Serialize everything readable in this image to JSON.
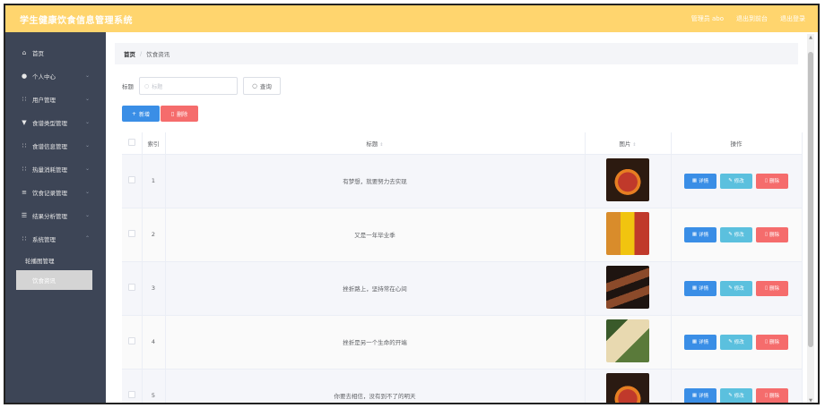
{
  "app": {
    "title": "学生健康饮食信息管理系统",
    "admin_label": "管理员 abo",
    "exit_backend": "退出到前台",
    "logout": "退出登录"
  },
  "sidebar": {
    "items": [
      {
        "label": "首页",
        "icon": "home-icon"
      },
      {
        "label": "个人中心",
        "icon": "user-icon"
      },
      {
        "label": "用户管理",
        "icon": "grid-icon"
      },
      {
        "label": "食谱类型管理",
        "icon": "filter-icon"
      },
      {
        "label": "食谱信息管理",
        "icon": "grid-icon"
      },
      {
        "label": "热量消耗管理",
        "icon": "grid-icon"
      },
      {
        "label": "饮食记录管理",
        "icon": "sliders-icon"
      },
      {
        "label": "结果分析管理",
        "icon": "list-icon"
      },
      {
        "label": "系统管理",
        "icon": "grid-icon"
      }
    ],
    "subitems": [
      {
        "label": "轮播图管理"
      },
      {
        "label": "饮食资讯"
      }
    ]
  },
  "breadcrumb": {
    "home": "首页",
    "separator": "/",
    "current": "饮食资讯"
  },
  "search": {
    "label": "标题",
    "placeholder": "标题",
    "button": "查询"
  },
  "actions": {
    "add": "新增",
    "delete": "删除"
  },
  "table": {
    "headers": {
      "index": "索引",
      "title": "标题",
      "image": "图片",
      "ops": "操作"
    },
    "rows": [
      {
        "index": "1",
        "title": "有梦想，就要努力去实现"
      },
      {
        "index": "2",
        "title": "又是一年毕业季"
      },
      {
        "index": "3",
        "title": "挫折路上，坚持常在心间"
      },
      {
        "index": "4",
        "title": "挫折是另一个生命的开端"
      },
      {
        "index": "5",
        "title": "你要去相信，没有到不了的明天"
      }
    ],
    "ops": {
      "detail": "详情",
      "edit": "修改",
      "delete": "删除"
    }
  },
  "colors": {
    "topbar": "#ffd56e",
    "sidebar": "#3d4556",
    "primary": "#3a8ee6",
    "edit": "#5bc0de",
    "danger": "#f56c6c"
  }
}
